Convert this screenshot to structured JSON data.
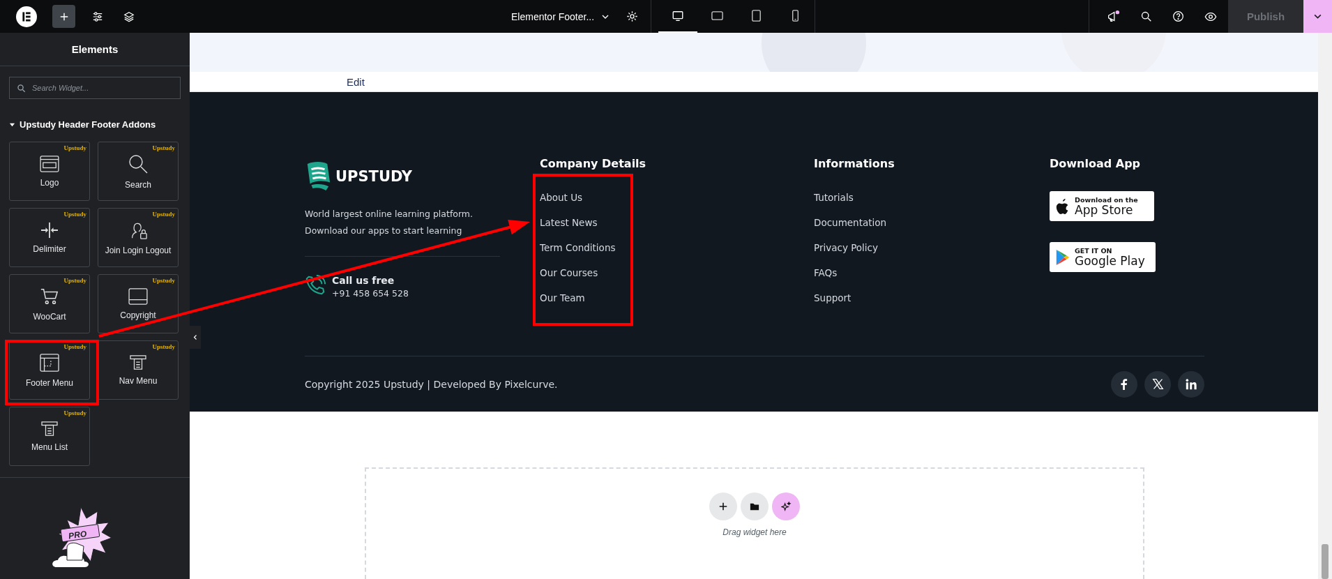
{
  "topbar": {
    "document_title": "Elementor Footer...",
    "devices": [
      {
        "kind": "desktop",
        "selected": true
      },
      {
        "kind": "tablet-landscape",
        "selected": false
      },
      {
        "kind": "tablet",
        "selected": false
      },
      {
        "kind": "mobile",
        "selected": false
      }
    ],
    "publish": {
      "label": "Publish",
      "disabled": true
    }
  },
  "panel": {
    "title": "Elements",
    "search": {
      "placeholder": "Search Widget..."
    },
    "category": {
      "label": "Upstudy Header Footer Addons",
      "expanded": true
    },
    "widgets": [
      {
        "label": "Logo",
        "badge": "Upstudy",
        "kind": "logo"
      },
      {
        "label": "Search",
        "badge": "Upstudy",
        "kind": "search"
      },
      {
        "label": "Delimiter",
        "badge": "Upstudy",
        "kind": "delimiter"
      },
      {
        "label": "Join Login Logout",
        "badge": "Upstudy",
        "kind": "user-lock"
      },
      {
        "label": "WooCart",
        "badge": "Upstudy",
        "kind": "cart"
      },
      {
        "label": "Copyright",
        "badge": "Upstudy",
        "kind": "copyright"
      },
      {
        "label": "Footer Menu",
        "badge": "Upstudy",
        "kind": "footer-menu"
      },
      {
        "label": "Nav Menu",
        "badge": "Upstudy",
        "kind": "nav-menu"
      },
      {
        "label": "Menu List",
        "badge": "Upstudy",
        "kind": "nav-menu"
      }
    ],
    "promo": {
      "badge": "PRO"
    }
  },
  "canvas": {
    "edit_link": "Edit",
    "footer": {
      "brand": "UPSTUDY",
      "description": "World largest online learning platform.\nDownload our apps to start learning",
      "call": {
        "title": "Call us free",
        "phone": "+91 458 654 528"
      },
      "columns": [
        {
          "heading": "Company Details",
          "links": [
            "About Us",
            "Latest News",
            "Term Conditions",
            "Our Courses",
            "Our Team"
          ]
        },
        {
          "heading": "Informations",
          "links": [
            "Tutorials",
            "Documentation",
            "Privacy Policy",
            "FAQs",
            "Support"
          ]
        }
      ],
      "download": {
        "heading": "Download App",
        "badges": [
          {
            "kind": "apple",
            "small": "Download on the",
            "large": "App Store"
          },
          {
            "kind": "google",
            "small": "GET IT ON",
            "large": "Google Play"
          }
        ]
      },
      "copyright": "Copyright 2025 Upstudy | Developed By Pixelcurve.",
      "social": [
        {
          "kind": "facebook"
        },
        {
          "kind": "x"
        },
        {
          "kind": "linkedin"
        }
      ]
    },
    "drop_zone": {
      "buttons": [
        {
          "kind": "add"
        },
        {
          "kind": "folder"
        },
        {
          "kind": "ai"
        }
      ],
      "hint": "Drag widget here"
    }
  }
}
